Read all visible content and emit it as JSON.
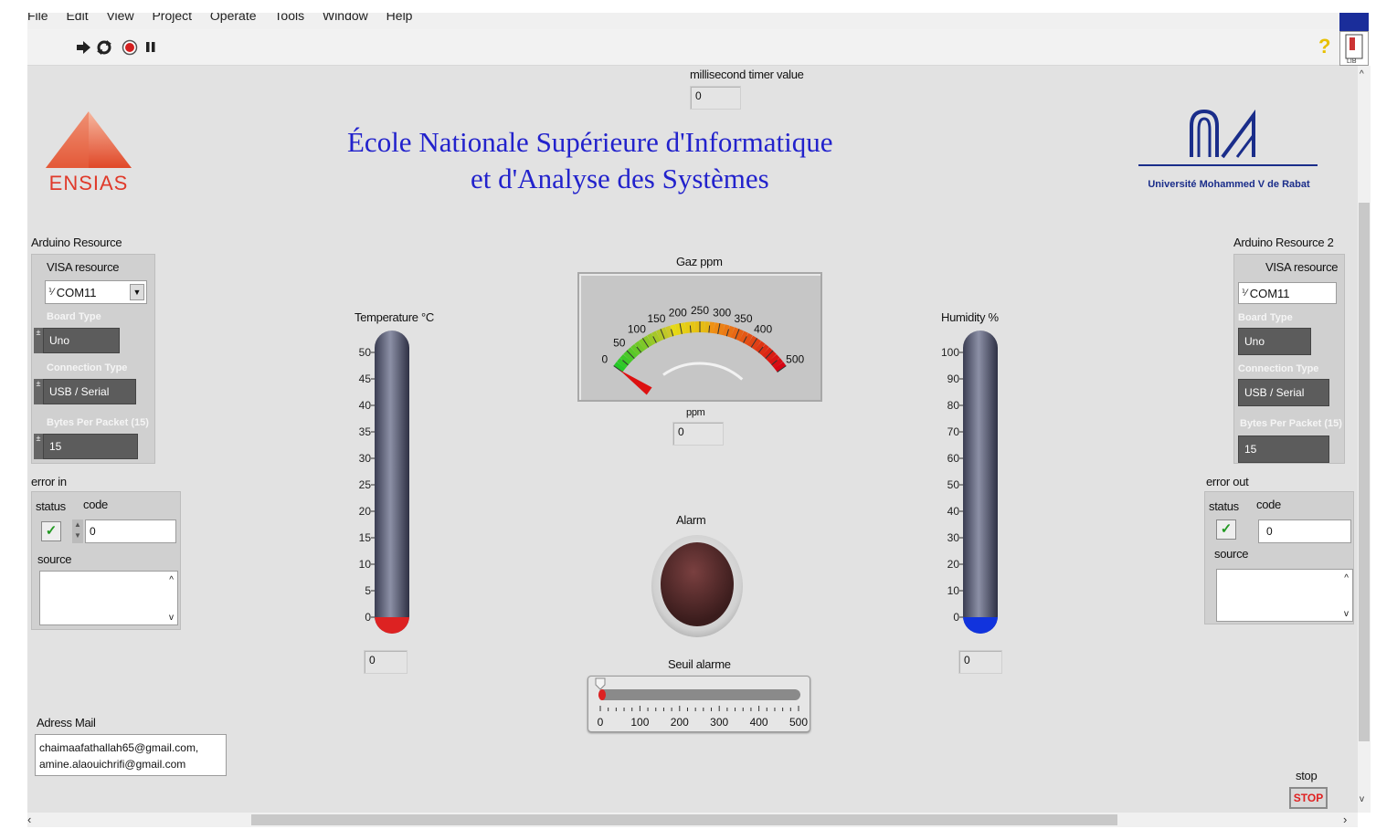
{
  "menu": [
    "File",
    "Edit",
    "View",
    "Project",
    "Operate",
    "Tools",
    "Window",
    "Help"
  ],
  "toolbar": {
    "run": "run-arrow-icon",
    "run_continuous": "run-continuously-icon",
    "abort": "abort-icon",
    "pause": "pause-icon",
    "help": "help-icon"
  },
  "timer": {
    "label": "millisecond timer value",
    "value": "0"
  },
  "logo": {
    "text": "ENSIAS"
  },
  "header": {
    "line1": "École Nationale Supérieure d'Informatique",
    "line2": "et d'Analyse des Systèmes"
  },
  "university": {
    "name": "Université Mohammed V de Rabat"
  },
  "arduino1": {
    "label": "Arduino Resource",
    "visa_label": "VISA resource",
    "visa_value": "COM11",
    "board_label": "Board Type",
    "board_value": "Uno",
    "conn_label": "Connection Type",
    "conn_value": "USB / Serial",
    "bytes_label": "Bytes Per Packet (15)",
    "bytes_value": "15"
  },
  "arduino2": {
    "label": "Arduino Resource 2",
    "visa_label": "VISA resource",
    "visa_value": "COM11",
    "board_label": "Board Type",
    "board_value": "Uno",
    "conn_label": "Connection Type",
    "conn_value": "USB / Serial",
    "bytes_label": "Bytes Per Packet (15)",
    "bytes_value": "15"
  },
  "error_in": {
    "label": "error in",
    "status_label": "status",
    "code_label": "code",
    "code_value": "0",
    "source_label": "source"
  },
  "error_out": {
    "label": "error out",
    "status_label": "status",
    "code_label": "code",
    "code_value": "0",
    "source_label": "source"
  },
  "temperature": {
    "label": "Temperature °C",
    "value": "0",
    "ticks": [
      "50",
      "45",
      "40",
      "35",
      "30",
      "25",
      "20",
      "15",
      "10",
      "5",
      "0"
    ],
    "level": 0,
    "color": "#dd2222"
  },
  "humidity": {
    "label": "Humidity %",
    "value": "0",
    "ticks": [
      "100",
      "90",
      "80",
      "70",
      "60",
      "50",
      "40",
      "30",
      "20",
      "10",
      "0"
    ],
    "level": 0,
    "color": "#1133dd"
  },
  "gauge": {
    "label": "Gaz ppm",
    "unit_label": "ppm",
    "value": "0",
    "ticks": [
      "0",
      "50",
      "100",
      "150",
      "200",
      "250",
      "300",
      "350",
      "400",
      "500"
    ]
  },
  "alarm": {
    "label": "Alarm"
  },
  "seuil": {
    "label": "Seuil alarme",
    "ticks": [
      "0",
      "100",
      "200",
      "300",
      "400",
      "500"
    ],
    "value": 0
  },
  "mail": {
    "label": "Adress Mail",
    "line1": "chaimaafathallah65@gmail.com,",
    "line2": "amine.alaouichrifi@gmail.com"
  },
  "stop": {
    "label": "stop",
    "button": "STOP"
  }
}
